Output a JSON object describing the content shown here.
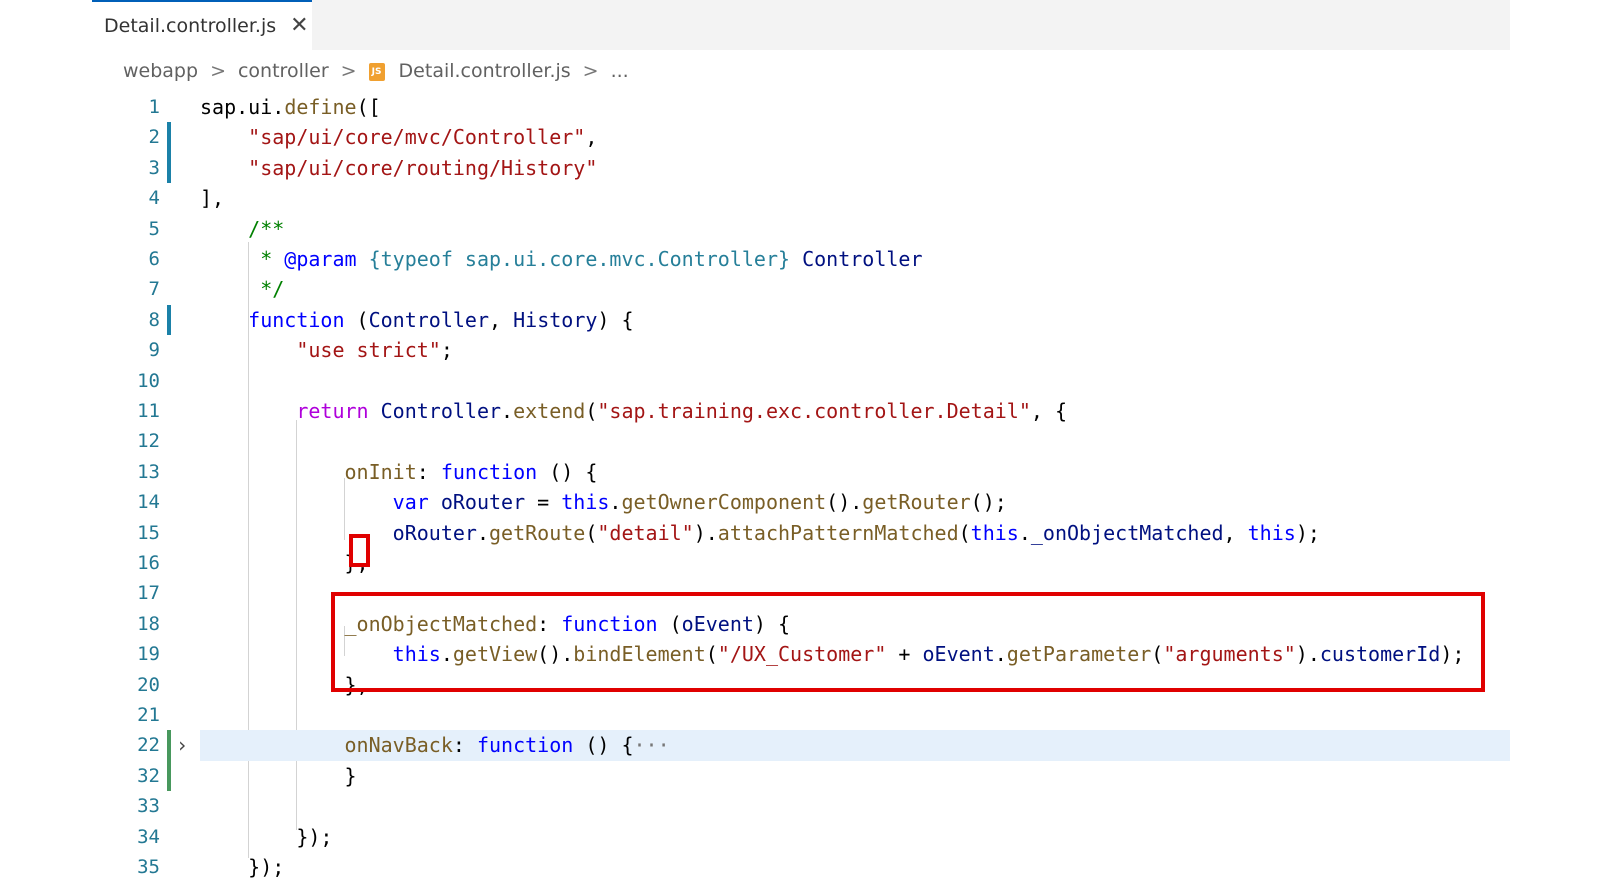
{
  "tab": {
    "filename": "Detail.controller.js",
    "close_glyph": "✕"
  },
  "breadcrumb": {
    "items": [
      "webapp",
      "controller",
      "Detail.controller.js",
      "..."
    ],
    "file_icon_label": "JS",
    "separator": ">"
  },
  "editor": {
    "lines": [
      {
        "num": "1",
        "tokens": [
          [
            "plain",
            "sap"
          ],
          [
            "plain",
            "."
          ],
          [
            "plain",
            "ui"
          ],
          [
            "plain",
            "."
          ],
          [
            "fn",
            "define"
          ],
          [
            "plain",
            "(["
          ]
        ]
      },
      {
        "num": "2",
        "tokens": [
          [
            "plain",
            "    "
          ],
          [
            "str",
            "\"sap/ui/core/mvc/Controller\""
          ],
          [
            "plain",
            ","
          ]
        ]
      },
      {
        "num": "3",
        "tokens": [
          [
            "plain",
            "    "
          ],
          [
            "str",
            "\"sap/ui/core/routing/History\""
          ]
        ]
      },
      {
        "num": "4",
        "tokens": [
          [
            "plain",
            "],"
          ]
        ]
      },
      {
        "num": "5",
        "tokens": [
          [
            "plain",
            "    "
          ],
          [
            "cm",
            "/**"
          ]
        ]
      },
      {
        "num": "6",
        "tokens": [
          [
            "plain",
            "    "
          ],
          [
            "cm",
            " * "
          ],
          [
            "tag",
            "@param"
          ],
          [
            "plain",
            " "
          ],
          [
            "type",
            "{typeof sap.ui.core.mvc.Controller}"
          ],
          [
            "plain",
            " "
          ],
          [
            "var",
            "Controller"
          ]
        ]
      },
      {
        "num": "7",
        "tokens": [
          [
            "plain",
            "    "
          ],
          [
            "cm",
            " */"
          ]
        ]
      },
      {
        "num": "8",
        "tokens": [
          [
            "plain",
            "    "
          ],
          [
            "kw",
            "function"
          ],
          [
            "plain",
            " ("
          ],
          [
            "var",
            "Controller"
          ],
          [
            "plain",
            ", "
          ],
          [
            "var",
            "History"
          ],
          [
            "plain",
            ") {"
          ]
        ]
      },
      {
        "num": "9",
        "tokens": [
          [
            "plain",
            "        "
          ],
          [
            "str",
            "\"use strict\""
          ],
          [
            "plain",
            ";"
          ]
        ]
      },
      {
        "num": "10",
        "tokens": []
      },
      {
        "num": "11",
        "tokens": [
          [
            "plain",
            "        "
          ],
          [
            "ctrl",
            "return"
          ],
          [
            "plain",
            " "
          ],
          [
            "var",
            "Controller"
          ],
          [
            "plain",
            "."
          ],
          [
            "fn",
            "extend"
          ],
          [
            "plain",
            "("
          ],
          [
            "str",
            "\"sap.training.exc.controller.Detail\""
          ],
          [
            "plain",
            ", {"
          ]
        ]
      },
      {
        "num": "12",
        "tokens": []
      },
      {
        "num": "13",
        "tokens": [
          [
            "plain",
            "            "
          ],
          [
            "fn",
            "onInit"
          ],
          [
            "plain",
            ": "
          ],
          [
            "kw",
            "function"
          ],
          [
            "plain",
            " () {"
          ]
        ]
      },
      {
        "num": "14",
        "tokens": [
          [
            "plain",
            "                "
          ],
          [
            "kw",
            "var"
          ],
          [
            "plain",
            " "
          ],
          [
            "var",
            "oRouter"
          ],
          [
            "plain",
            " = "
          ],
          [
            "kw",
            "this"
          ],
          [
            "plain",
            "."
          ],
          [
            "fn",
            "getOwnerComponent"
          ],
          [
            "plain",
            "()."
          ],
          [
            "fn",
            "getRouter"
          ],
          [
            "plain",
            "();"
          ]
        ]
      },
      {
        "num": "15",
        "tokens": [
          [
            "plain",
            "                "
          ],
          [
            "var",
            "oRouter"
          ],
          [
            "plain",
            "."
          ],
          [
            "fn",
            "getRoute"
          ],
          [
            "plain",
            "("
          ],
          [
            "str",
            "\"detail\""
          ],
          [
            "plain",
            ")."
          ],
          [
            "fn",
            "attachPatternMatched"
          ],
          [
            "plain",
            "("
          ],
          [
            "kw",
            "this"
          ],
          [
            "plain",
            "."
          ],
          [
            "var",
            "_onObjectMatched"
          ],
          [
            "plain",
            ", "
          ],
          [
            "kw",
            "this"
          ],
          [
            "plain",
            ");"
          ]
        ]
      },
      {
        "num": "16",
        "tokens": [
          [
            "plain",
            "            },"
          ]
        ]
      },
      {
        "num": "17",
        "tokens": []
      },
      {
        "num": "18",
        "tokens": [
          [
            "plain",
            "            "
          ],
          [
            "fn",
            "_onObjectMatched"
          ],
          [
            "plain",
            ": "
          ],
          [
            "kw",
            "function"
          ],
          [
            "plain",
            " ("
          ],
          [
            "var",
            "oEvent"
          ],
          [
            "plain",
            ") {"
          ]
        ]
      },
      {
        "num": "19",
        "tokens": [
          [
            "plain",
            "                "
          ],
          [
            "kw",
            "this"
          ],
          [
            "plain",
            "."
          ],
          [
            "fn",
            "getView"
          ],
          [
            "plain",
            "()."
          ],
          [
            "fn",
            "bindElement"
          ],
          [
            "plain",
            "("
          ],
          [
            "str",
            "\"/UX_Customer\""
          ],
          [
            "plain",
            " + "
          ],
          [
            "var",
            "oEvent"
          ],
          [
            "plain",
            "."
          ],
          [
            "fn",
            "getParameter"
          ],
          [
            "plain",
            "("
          ],
          [
            "str",
            "\"arguments\""
          ],
          [
            "plain",
            ")."
          ],
          [
            "var",
            "customerId"
          ],
          [
            "plain",
            ");"
          ]
        ]
      },
      {
        "num": "20",
        "tokens": [
          [
            "plain",
            "            },"
          ]
        ]
      },
      {
        "num": "21",
        "tokens": []
      },
      {
        "num": "22",
        "tokens": [
          [
            "plain",
            "            "
          ],
          [
            "fn",
            "onNavBack"
          ],
          [
            "plain",
            ": "
          ],
          [
            "kw",
            "function"
          ],
          [
            "plain",
            " () {"
          ],
          [
            "ellipsis",
            "···"
          ]
        ]
      },
      {
        "num": "32",
        "tokens": [
          [
            "plain",
            "            }"
          ]
        ]
      },
      {
        "num": "33",
        "tokens": []
      },
      {
        "num": "34",
        "tokens": [
          [
            "plain",
            "        });"
          ]
        ]
      },
      {
        "num": "35",
        "tokens": [
          [
            "plain",
            "    });"
          ]
        ]
      }
    ],
    "fold_glyph": "›"
  },
  "colors": {
    "keyword": "#0000ff",
    "control": "#af00db",
    "string": "#a31515",
    "comment": "#008000",
    "line_number": "#237893",
    "annotation_red": "#e00000",
    "highlight_line": "#e5f0fb"
  }
}
